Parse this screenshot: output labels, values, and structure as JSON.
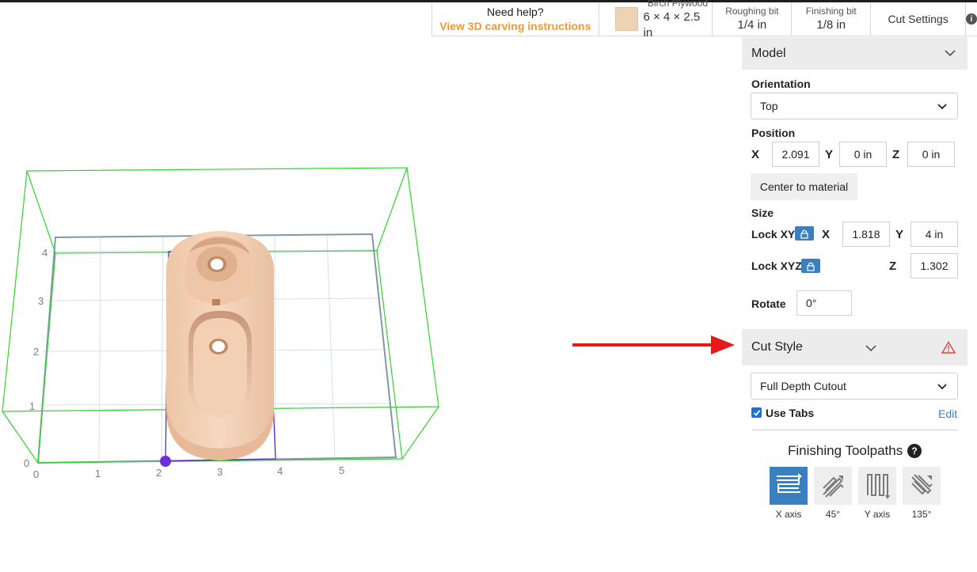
{
  "topbar": {
    "help_title": "Need help?",
    "help_link": "View 3D carving instructions",
    "material_name": "Birch Plywood",
    "material_size": "6 × 4 × 2.5 in",
    "roughing_label": "Roughing bit",
    "roughing_value": "1/4 in",
    "finishing_label": "Finishing bit",
    "finishing_value": "1/8 in",
    "cut_settings": "Cut Settings",
    "info": "i"
  },
  "viewport": {
    "x_ticks": [
      "0",
      "1",
      "2",
      "3",
      "4",
      "5"
    ],
    "y_ticks": [
      "0",
      "1",
      "2",
      "3",
      "4"
    ]
  },
  "model": {
    "title": "Model",
    "orientation_label": "Orientation",
    "orientation_value": "Top",
    "position_label": "Position",
    "pos_x_label": "X",
    "pos_x": "2.091",
    "pos_y_label": "Y",
    "pos_y": "0 in",
    "pos_z_label": "Z",
    "pos_z": "0 in",
    "center_button": "Center to material",
    "size_label": "Size",
    "lock_xy_label": "Lock XY",
    "size_x_label": "X",
    "size_x": "1.818",
    "size_y_label": "Y",
    "size_y": "4 in",
    "lock_xyz_label": "Lock XYZ",
    "size_z_label": "Z",
    "size_z": "1.302",
    "rotate_label": "Rotate",
    "rotate_value": "0°"
  },
  "cut_style": {
    "title": "Cut Style",
    "select_value": "Full Depth Cutout",
    "use_tabs_label": "Use Tabs",
    "use_tabs_checked": true,
    "edit_link": "Edit"
  },
  "finishing": {
    "title": "Finishing Toolpaths",
    "help": "?",
    "options": [
      {
        "label": "X axis",
        "icon": "x-axis-toolpath-icon",
        "active": true
      },
      {
        "label": "45°",
        "icon": "45-degree-toolpath-icon",
        "active": false
      },
      {
        "label": "Y axis",
        "icon": "y-axis-toolpath-icon",
        "active": false
      },
      {
        "label": "135°",
        "icon": "135-degree-toolpath-icon",
        "active": false
      }
    ]
  },
  "colors": {
    "accent": "#3a80c1",
    "help_link": "#f29a2e",
    "warning": "#e0453a",
    "arrow": "#e3191c",
    "model": "#f3d0b5",
    "bounding_green": "#2fd42f",
    "model_box_purple": "#5b2bb5"
  }
}
